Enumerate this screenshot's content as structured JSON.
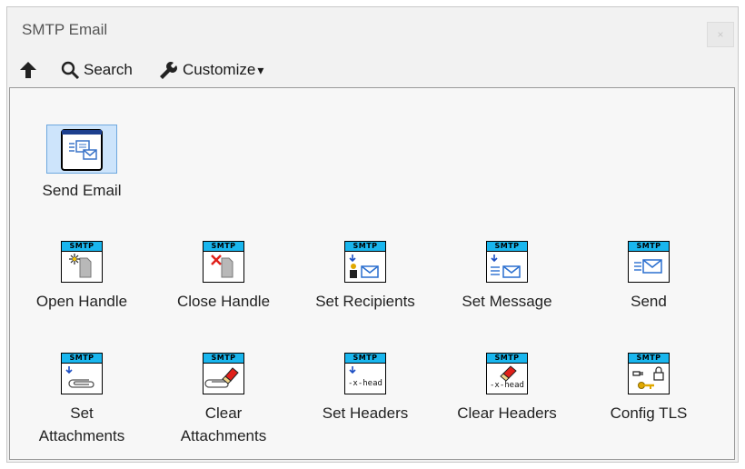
{
  "window": {
    "title": "SMTP Email",
    "close_glyph": "×"
  },
  "toolbar": {
    "up_icon": "arrow-up-icon",
    "search_label": "Search",
    "customize_label": "Customize",
    "customize_arrow": "▾"
  },
  "palette": {
    "send_email": {
      "label": "Send Email",
      "icon": "email-vi-icon",
      "selected": true
    },
    "badge_text": "SMTP",
    "row1": [
      {
        "label": "Open Handle",
        "icon": "open-handle-icon"
      },
      {
        "label": "Close Handle",
        "icon": "close-handle-icon"
      },
      {
        "label": "Set Recipients",
        "icon": "set-recipients-icon"
      },
      {
        "label": "Set Message",
        "icon": "set-message-icon"
      },
      {
        "label": "Send",
        "icon": "send-icon"
      }
    ],
    "row2": [
      {
        "label": "Set\nAttachments",
        "icon": "set-attachments-icon"
      },
      {
        "label": "Clear\nAttachments",
        "icon": "clear-attachments-icon"
      },
      {
        "label": "Set Headers",
        "icon": "set-headers-icon",
        "body_text": "-x-head"
      },
      {
        "label": "Clear Headers",
        "icon": "clear-headers-icon",
        "body_text": "-x-head"
      },
      {
        "label": "Config TLS",
        "icon": "config-tls-icon"
      }
    ]
  },
  "colors": {
    "smtp_badge": "#19b6ee",
    "selection_fill": "#cde4fb",
    "selection_border": "#6ea8de"
  }
}
